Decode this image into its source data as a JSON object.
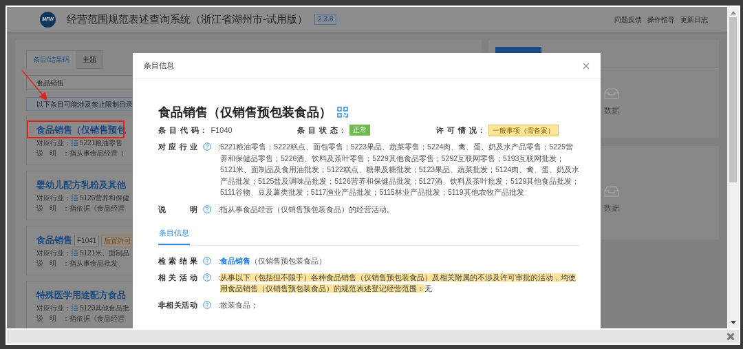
{
  "header": {
    "logo_text": "MFW",
    "title": "经营范围规范表述查询系统（浙江省湖州市-试用版）",
    "version": "2.3.8",
    "links": [
      "问题反馈",
      "操作指导",
      "更新日志"
    ]
  },
  "left_panel": {
    "tabs": [
      {
        "label": "条目/结果码",
        "selected": true
      },
      {
        "label": "主题",
        "selected": false
      }
    ],
    "search": {
      "value": "食品销售"
    },
    "notice": "以下条目可能涉及禁止限制目录",
    "results": [
      {
        "title": "食品销售（仅销售预包",
        "annotated": true,
        "rows": [
          {
            "kind": "industry",
            "label": "对应行业：",
            "value": "5221粮油零售"
          },
          {
            "kind": "description",
            "label": "说明：",
            "value": "指从事食品经营（"
          }
        ]
      },
      {
        "title": "婴幼儿配方乳粉及其他",
        "annotated": false,
        "rows": [
          {
            "kind": "industry",
            "label": "对应行业：",
            "value": "5126营养和保健"
          },
          {
            "kind": "description",
            "label": "说明：",
            "value": "指依据《食品经营"
          }
        ]
      },
      {
        "title": "食品销售",
        "code": "F1041",
        "badge": "后置许可",
        "annotated": false,
        "rows": [
          {
            "kind": "industry",
            "label": "对应行业：",
            "value": "5121米、面制品"
          },
          {
            "kind": "description",
            "label": "说明：",
            "value": "指从事食品批发、"
          }
        ]
      },
      {
        "title": "特殊医学用途配方食品",
        "annotated": false,
        "rows": [
          {
            "kind": "industry",
            "label": "对应行业：",
            "value": "5129其他食品批"
          },
          {
            "kind": "description",
            "label": "说明：",
            "value": "指依据《食品经营"
          }
        ]
      }
    ]
  },
  "right_panel": {
    "cards": [
      {
        "empty_text": "数据"
      },
      {
        "empty_text": "数据"
      }
    ]
  },
  "modal": {
    "title": "条目信息",
    "heading": "食品销售（仅销售预包装食品）",
    "fields": [
      {
        "kind": "text",
        "label": "条目代码:",
        "value": "F1040"
      },
      {
        "kind": "status",
        "label": "条目状态:",
        "value": "正常"
      },
      {
        "kind": "permit",
        "label": "许可情况:",
        "value": "一般事项（需备案）"
      }
    ],
    "details": [
      {
        "label": "对应行业",
        "colon": ":",
        "value": "5221粮油零售；5222糕点、面包零售；5223果品、蔬菜零售；5224肉、禽、蛋、奶及水产品零售；5225营养和保健品零售；5226酒、饮料及茶叶零售；5229其他食品零售；5292互联网零售；5193互联网批发；5121米、面制品及食用油批发；5122糕点、糖果及糖批发；5123果品、蔬菜批发；5124肉、禽、蛋、奶及水产品批发；5125盐及调味品批发；5126营养和保健品批发；5127酒、饮料及茶叶批发；5129其他食品批发；5111谷物、豆及薯类批发；5117渔业产品批发；5115林业产品批发；5119其他农牧产品批发"
      },
      {
        "label": "说明",
        "colon": ":",
        "value": "指从事食品经营（仅销售预包装食品）的经营活动。"
      }
    ],
    "tabs": [
      {
        "label": "条目信息",
        "selected": true
      }
    ],
    "info": [
      {
        "kind": "link",
        "label": "检索结果",
        "colon": ":",
        "link": "食品销售",
        "value": "（仅销售预包装食品）"
      },
      {
        "kind": "highlight",
        "label": "相关活动",
        "colon": ":",
        "highlight": "从事以下（包括但不限于）各种食品销售（仅销售预包装食品）及相关附属的不涉及许可审批的活动，均使用食品销售（仅销售预包装食品）的规范表述登记经营范围：",
        "value": "无"
      },
      {
        "kind": "plain",
        "label": "非相关活动",
        "colon": ":",
        "value": "散装食品；"
      }
    ]
  }
}
